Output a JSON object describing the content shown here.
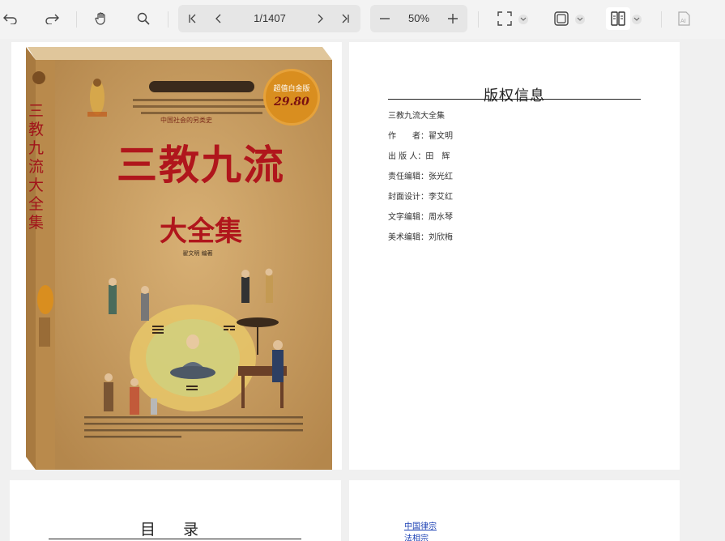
{
  "toolbar": {
    "page_indicator": "1/1407",
    "zoom_level": "50%",
    "icons": [
      "undo-icon",
      "redo-icon",
      "hand-icon",
      "search-icon",
      "first-page-icon",
      "prev-page-icon",
      "next-page-icon",
      "last-page-icon",
      "zoom-out-icon",
      "zoom-in-icon",
      "fit-page-icon",
      "fit-width-icon",
      "dual-page-icon",
      "ai-icon"
    ]
  },
  "cover": {
    "title": "三教九流",
    "subtitle": "大全集",
    "spine_title": "三教九流大全集",
    "price_badge_top": "超值白金版",
    "price_badge_price": "29.80",
    "tagline": "中国社会的另类史",
    "author_line": "翟文明 编著",
    "colors": {
      "bg": "#c99a5b",
      "title": "#b0161c",
      "spine": "#b98a4c"
    }
  },
  "copyright_page": {
    "heading": "版权信息",
    "lines": [
      "三教九流大全集",
      "作　　者：翟文明",
      "出 版 人：田　辉",
      "责任编辑：张光红",
      "封面设计：李艾红",
      "文字编辑：周水琴",
      "美术编辑：刘欣梅"
    ]
  },
  "toc_page": {
    "heading": "目 录"
  },
  "links_page": {
    "links": [
      "中国律宗",
      "法相宗"
    ]
  }
}
